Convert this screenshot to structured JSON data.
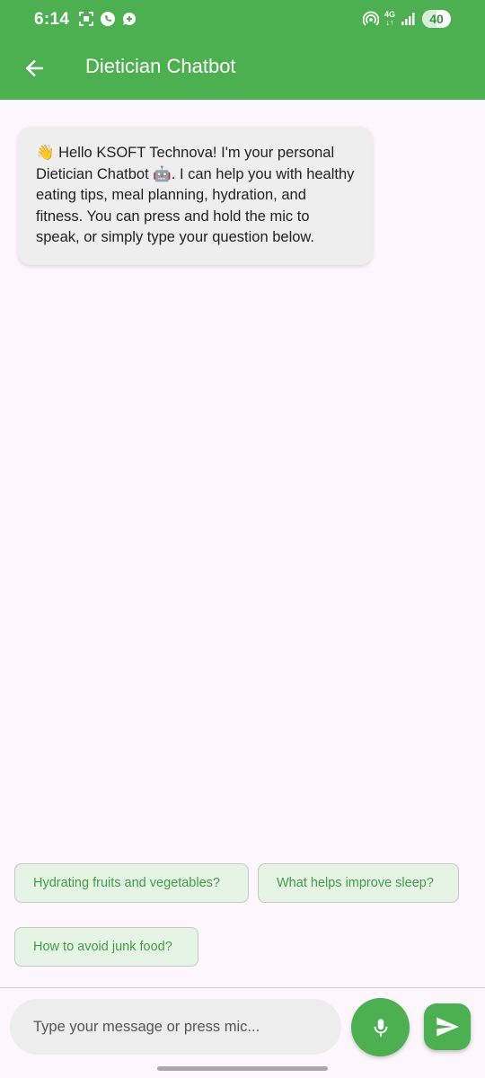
{
  "status_bar": {
    "time": "6:14",
    "network": "4G",
    "battery": "40"
  },
  "appbar": {
    "title": "Dietician Chatbot"
  },
  "messages": [
    {
      "sender": "bot",
      "text": "👋 Hello KSOFT Technova! I'm your personal Dietician Chatbot 🤖. I can help you with healthy eating tips, meal planning, hydration, and fitness. You can press and hold the mic to speak, or simply type your question below."
    }
  ],
  "suggestions": [
    "Hydrating fruits and vegetables?",
    "What helps improve sleep?",
    "How to avoid junk food?"
  ],
  "composer": {
    "placeholder": "Type your message or press mic...",
    "value": ""
  },
  "colors": {
    "primary": "#4caf50",
    "background": "#fdf6fc",
    "bubble": "#eeeeee",
    "chip_background": "#e6f4e6",
    "chip_text": "#3f9e43"
  }
}
